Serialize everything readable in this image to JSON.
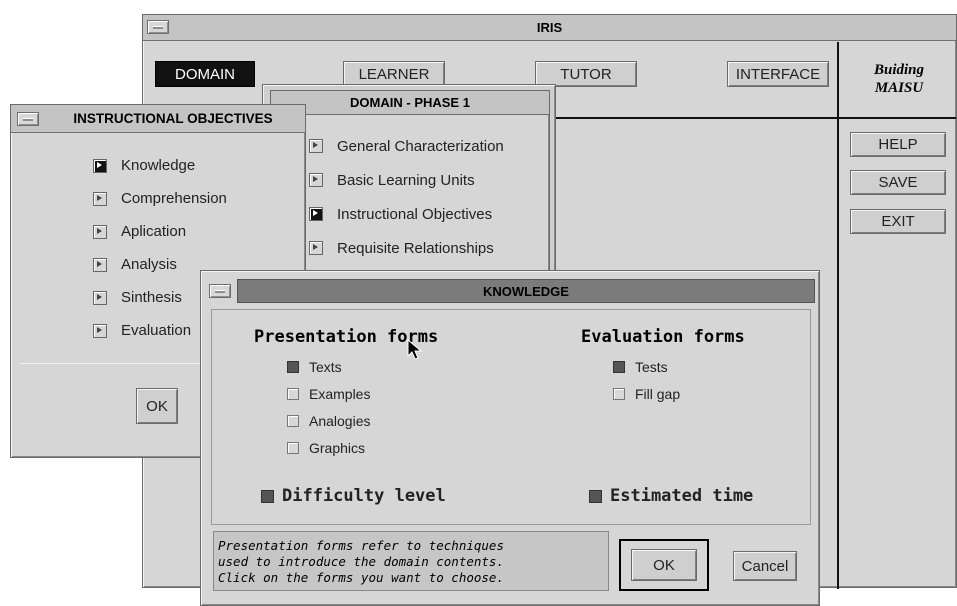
{
  "iris": {
    "title": "IRIS",
    "tabs": [
      "DOMAIN",
      "LEARNER",
      "TUTOR",
      "INTERFACE"
    ],
    "brand": [
      "Buiding",
      "MAISU"
    ],
    "side_buttons": [
      "HELP",
      "SAVE",
      "EXIT"
    ]
  },
  "phase": {
    "title": "DOMAIN - PHASE 1",
    "items": [
      "General Characterization",
      "Basic Learning Units",
      "Instructional Objectives",
      "Requisite Relationships"
    ]
  },
  "objectives": {
    "title": "INSTRUCTIONAL OBJECTIVES",
    "items": [
      "Knowledge",
      "Comprehension",
      "Aplication",
      "Analysis",
      "Sinthesis",
      "Evaluation"
    ],
    "ok_label": "OK"
  },
  "knowledge": {
    "title": "KNOWLEDGE",
    "presentation_heading": "Presentation forms",
    "presentation_items": [
      "Texts",
      "Examples",
      "Analogies",
      "Graphics"
    ],
    "evaluation_heading": "Evaluation forms",
    "evaluation_items": [
      "Tests",
      "Fill gap"
    ],
    "difficulty_label": "Difficulty level",
    "estimated_label": "Estimated time",
    "help_lines": [
      "Presentation forms refer to techniques",
      "used to introduce the domain contents.",
      "Click on the forms you want to choose."
    ],
    "ok_label": "OK",
    "cancel_label": "Cancel"
  },
  "colors": {
    "window_bg": "#d6d6d6",
    "active_tab": "#111111",
    "titlebar": "#c4c4c4"
  }
}
